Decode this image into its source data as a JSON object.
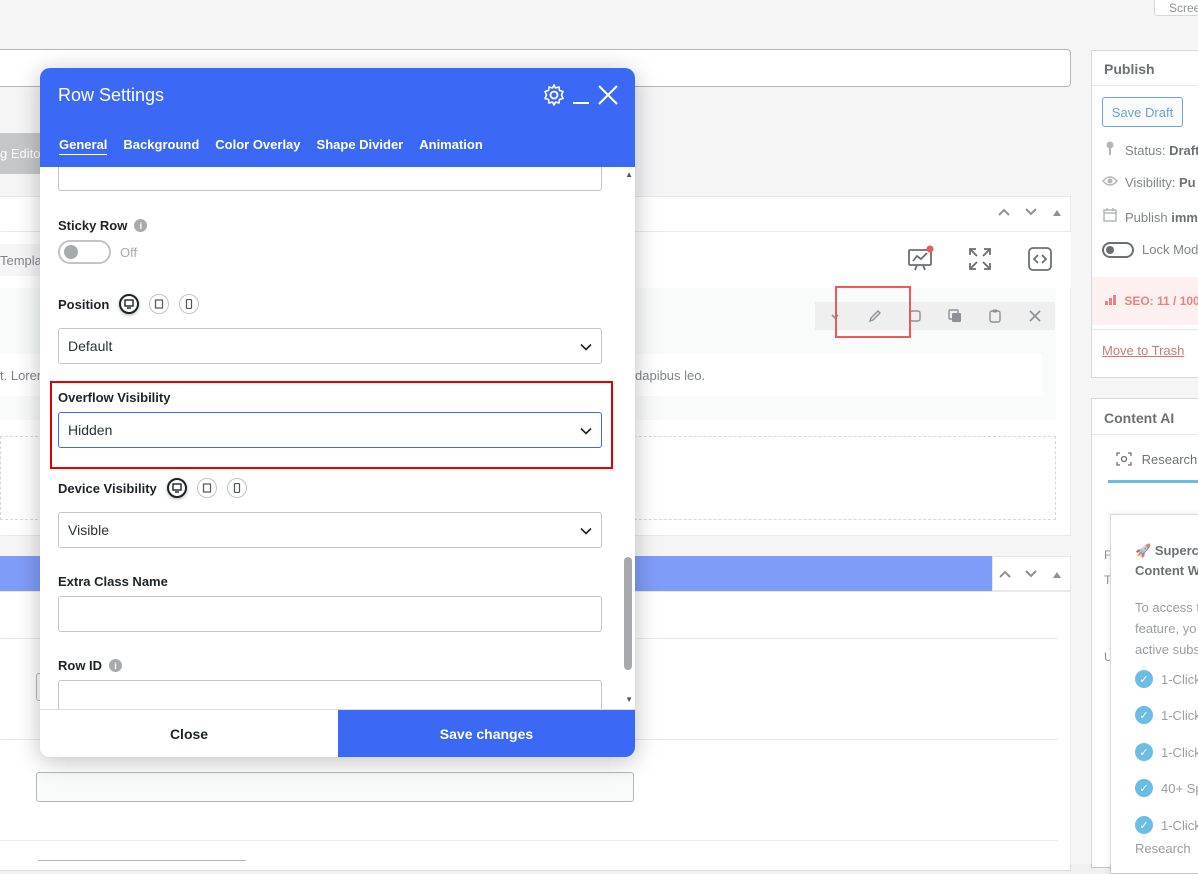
{
  "background": {
    "screen_options_label": "Scree",
    "editor_tab_label": "g Edito",
    "templates_tab_label": "Templa",
    "text_left": "t. Lorem",
    "text_right": "dapibus leo."
  },
  "publish": {
    "title": "Publish",
    "save_draft": "Save Draft",
    "status_label": "Status:",
    "status_value": "Draft",
    "visibility_label": "Visibility:",
    "visibility_value": "Pu",
    "publish_label": "Publish",
    "publish_value": "imm",
    "lock_label": "Lock Mod",
    "seo": "SEO: 11 / 100",
    "trash": "Move to Trash"
  },
  "content_ai": {
    "title": "Content AI",
    "research_tab": "Research",
    "upsell_title_1": "Superc",
    "upsell_title_2": "Content W",
    "desc_1": "To access t",
    "desc_2": "feature, yo",
    "desc_3": "active subs",
    "features": [
      "1-Click",
      "1-Click",
      "1-Click",
      "40+ Sp",
      "1-Click"
    ],
    "last_line": "Research",
    "frag_f": "F",
    "frag_t": "T",
    "frag_u": "U"
  },
  "modal": {
    "title": "Row Settings",
    "tabs": [
      "General",
      "Background",
      "Color Overlay",
      "Shape Divider",
      "Animation"
    ],
    "sticky_row_label": "Sticky Row",
    "sticky_row_state": "Off",
    "position_label": "Position",
    "position_value": "Default",
    "overflow_label": "Overflow Visibility",
    "overflow_value": "Hidden",
    "device_label": "Device Visibility",
    "device_value": "Visible",
    "extra_class_label": "Extra Class Name",
    "row_id_label": "Row ID",
    "close_label": "Close",
    "save_label": "Save changes"
  },
  "colors": {
    "accent": "#3c68f6",
    "highlight": "#e30000",
    "seo_red": "#e03e3e"
  }
}
